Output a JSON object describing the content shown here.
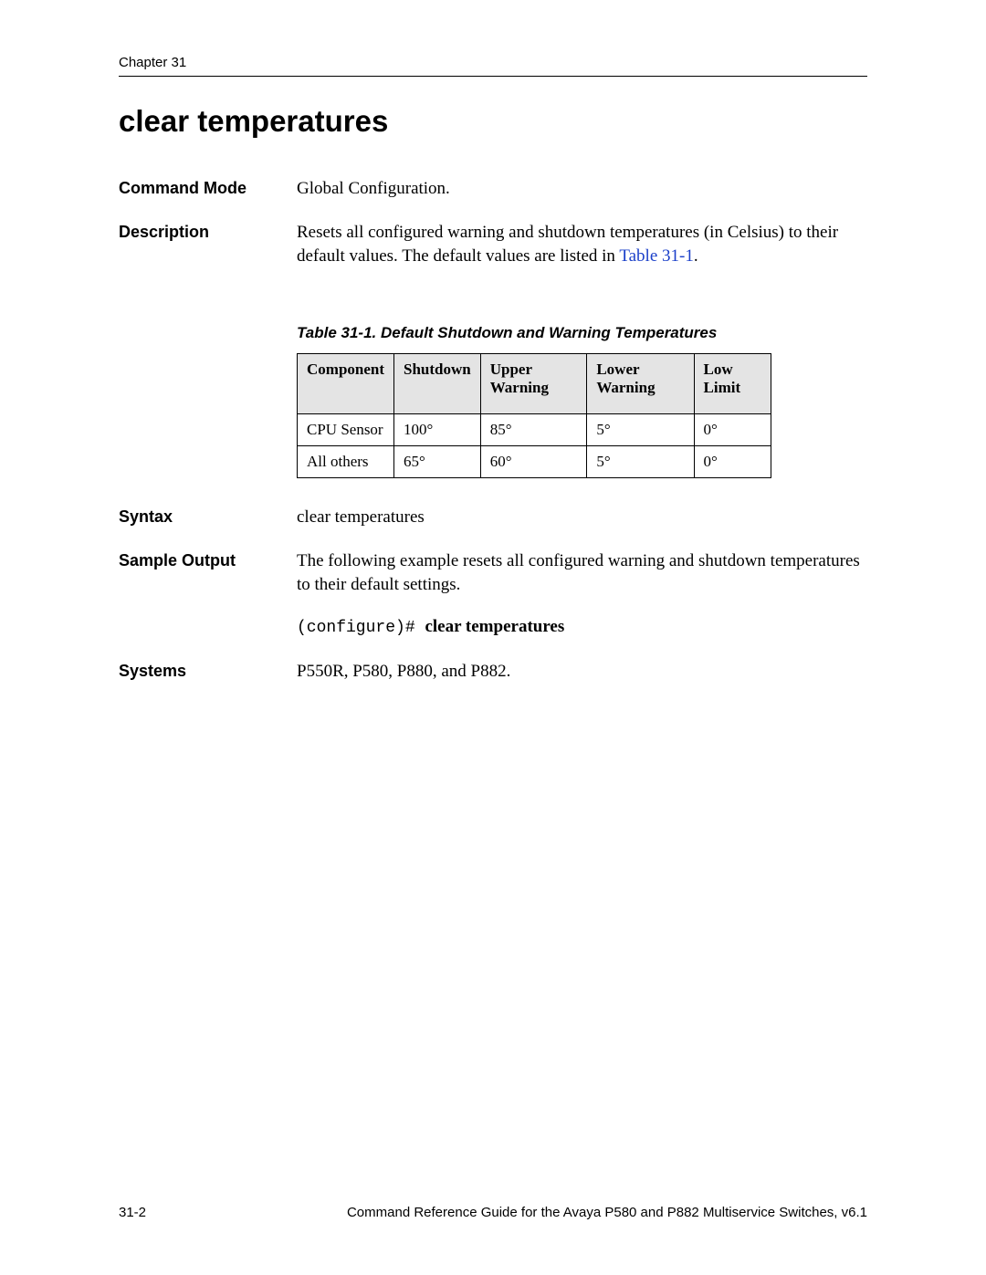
{
  "header": {
    "chapter": "Chapter 31"
  },
  "title": "clear temperatures",
  "sections": {
    "command_mode": {
      "label": "Command Mode",
      "text": "Global Configuration."
    },
    "description": {
      "label": "Description",
      "text_before_link": "Resets all configured warning and shutdown temperatures (in Celsius) to their default values. The default values are listed in ",
      "link_text": "Table 31-1",
      "text_after_link": "."
    },
    "syntax": {
      "label": "Syntax",
      "text": "clear temperatures"
    },
    "sample_output": {
      "label": "Sample Output",
      "text": "The following example resets all configured warning and shutdown temperatures to their default settings.",
      "prompt": "(configure)# ",
      "cmd": "clear temperatures"
    },
    "systems": {
      "label": "Systems",
      "text": "P550R, P580, P880, and P882."
    }
  },
  "table": {
    "caption": "Table 31-1.  Default Shutdown and Warning Temperatures",
    "headers": [
      "Component",
      "Shutdown",
      "Upper Warning",
      "Lower Warning",
      "Low Limit"
    ],
    "rows": [
      [
        "CPU Sensor",
        "100°",
        "85°",
        "5°",
        "0°"
      ],
      [
        "All others",
        "65°",
        "60°",
        "5°",
        "0°"
      ]
    ]
  },
  "footer": {
    "page": "31-2",
    "doc": "Command Reference Guide for the Avaya P580 and P882 Multiservice Switches, v6.1"
  }
}
